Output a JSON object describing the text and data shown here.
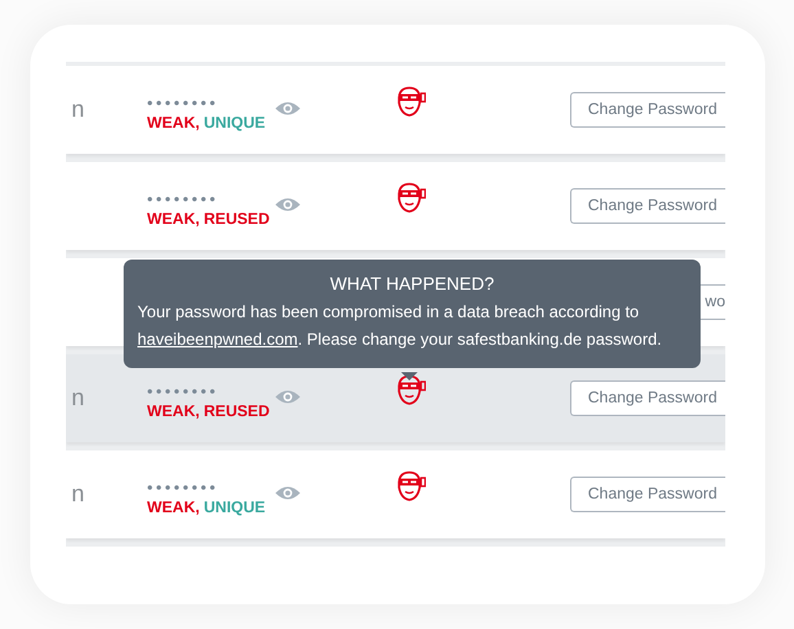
{
  "rows": [
    {
      "site": "n",
      "masked": "••••••••",
      "strength": [
        {
          "text": "WEAK,",
          "color": "#e2001a"
        },
        {
          "text": "UNIQUE",
          "color": "#3aa99f"
        }
      ],
      "button": "Change Password",
      "selected": false
    },
    {
      "masked": "••••••••",
      "strength": [
        {
          "text": "WEAK,",
          "color": "#e2001a"
        },
        {
          "text": "REUSED",
          "color": "#e2001a"
        }
      ],
      "button": "Change Password",
      "selected": false
    },
    {
      "button": "wo",
      "selected": false
    },
    {
      "site": "n",
      "masked": "••••••••",
      "strength": [
        {
          "text": "WEAK,",
          "color": "#e2001a"
        },
        {
          "text": "REUSED",
          "color": "#e2001a"
        }
      ],
      "button": "Change Password",
      "selected": true
    },
    {
      "site": "n",
      "masked": "••••••••",
      "strength": [
        {
          "text": "WEAK,",
          "color": "#e2001a"
        },
        {
          "text": "UNIQUE",
          "color": "#3aa99f"
        }
      ],
      "button": "Change Password",
      "selected": false
    },
    {
      "selected": false
    }
  ],
  "tooltip": {
    "title": "WHAT HAPPENED?",
    "message_before": "Your password has been compromised in a data breach according to",
    "link": "haveibeenpwned.com",
    "message_after": ". Please change your safestbanking.de password."
  }
}
